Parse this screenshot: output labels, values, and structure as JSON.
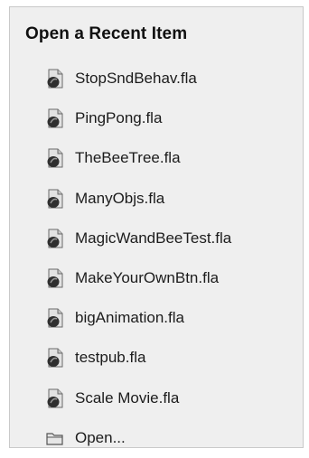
{
  "panel": {
    "title": "Open a Recent Item",
    "items": [
      {
        "label": "StopSndBehav.fla",
        "icon": "fla-file-icon"
      },
      {
        "label": "PingPong.fla",
        "icon": "fla-file-icon"
      },
      {
        "label": "TheBeeTree.fla",
        "icon": "fla-file-icon"
      },
      {
        "label": "ManyObjs.fla",
        "icon": "fla-file-icon"
      },
      {
        "label": "MagicWandBeeTest.fla",
        "icon": "fla-file-icon"
      },
      {
        "label": "MakeYourOwnBtn.fla",
        "icon": "fla-file-icon"
      },
      {
        "label": "bigAnimation.fla",
        "icon": "fla-file-icon"
      },
      {
        "label": "testpub.fla",
        "icon": "fla-file-icon"
      },
      {
        "label": "Scale Movie.fla",
        "icon": "fla-file-icon"
      }
    ],
    "open": {
      "label": "Open...",
      "icon": "folder-icon"
    }
  },
  "colors": {
    "panel_bg": "#efefef",
    "panel_border": "#c9c9c9",
    "text": "#1c1c1c"
  }
}
